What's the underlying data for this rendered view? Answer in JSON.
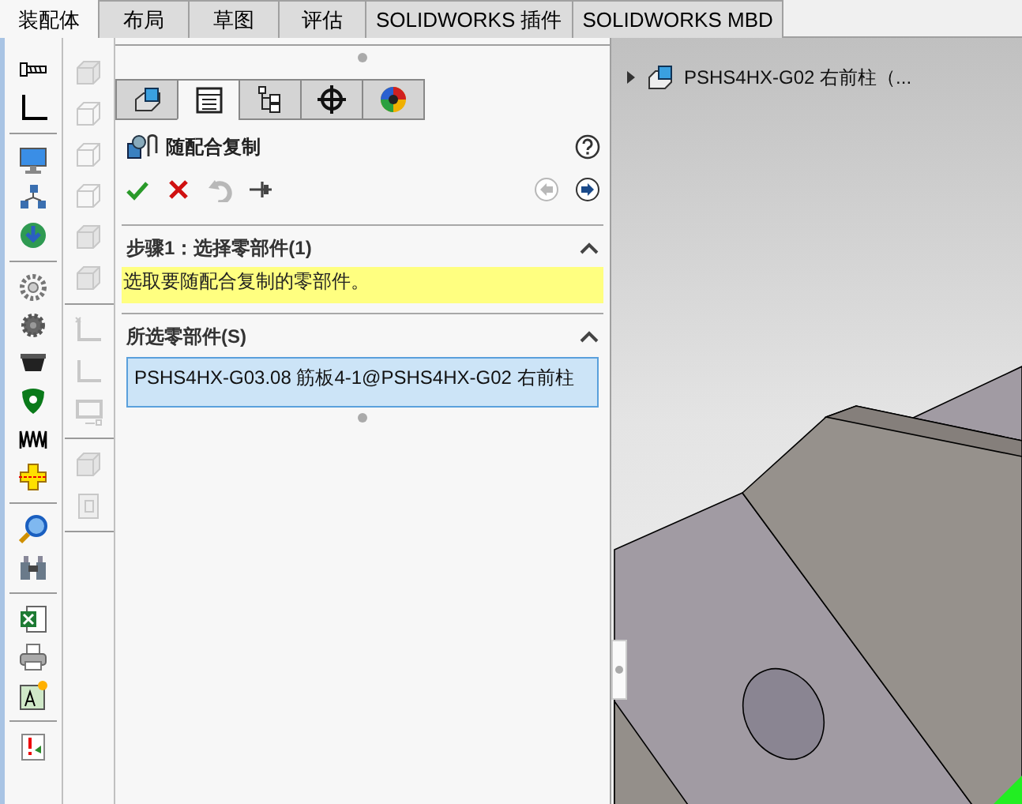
{
  "command_tabs": [
    {
      "label": "装配体",
      "selected": true
    },
    {
      "label": "布局",
      "selected": false
    },
    {
      "label": "草图",
      "selected": false
    },
    {
      "label": "评估",
      "selected": false
    },
    {
      "label": "SOLIDWORKS 插件",
      "selected": false
    },
    {
      "label": "SOLIDWORKS MBD",
      "selected": false
    }
  ],
  "manager_tabs": [
    {
      "selected": false
    },
    {
      "selected": true
    },
    {
      "selected": false
    },
    {
      "selected": false
    },
    {
      "selected": false
    }
  ],
  "property_manager": {
    "title": "随配合复制",
    "actions": [
      {
        "kind": "ok",
        "disabled": false
      },
      {
        "kind": "cancel",
        "disabled": false
      },
      {
        "kind": "undo",
        "disabled": true
      },
      {
        "kind": "pin",
        "disabled": false
      }
    ],
    "nav": [
      {
        "kind": "back",
        "disabled": true
      },
      {
        "kind": "next",
        "disabled": false
      }
    ],
    "sections": [
      {
        "title": "步骤1：选择零部件(1)",
        "expanded": true,
        "message": "选取要随配合复制的零部件。"
      },
      {
        "title": "所选零部件(S)",
        "expanded": true,
        "items": [
          "PSHS4HX-G03.08  筋板4-1@PSHS4HX-G02  右前柱"
        ]
      }
    ]
  },
  "graphics": {
    "tree_item": {
      "label": "PSHS4HX-G02  右前柱（...",
      "expanded": false
    }
  }
}
